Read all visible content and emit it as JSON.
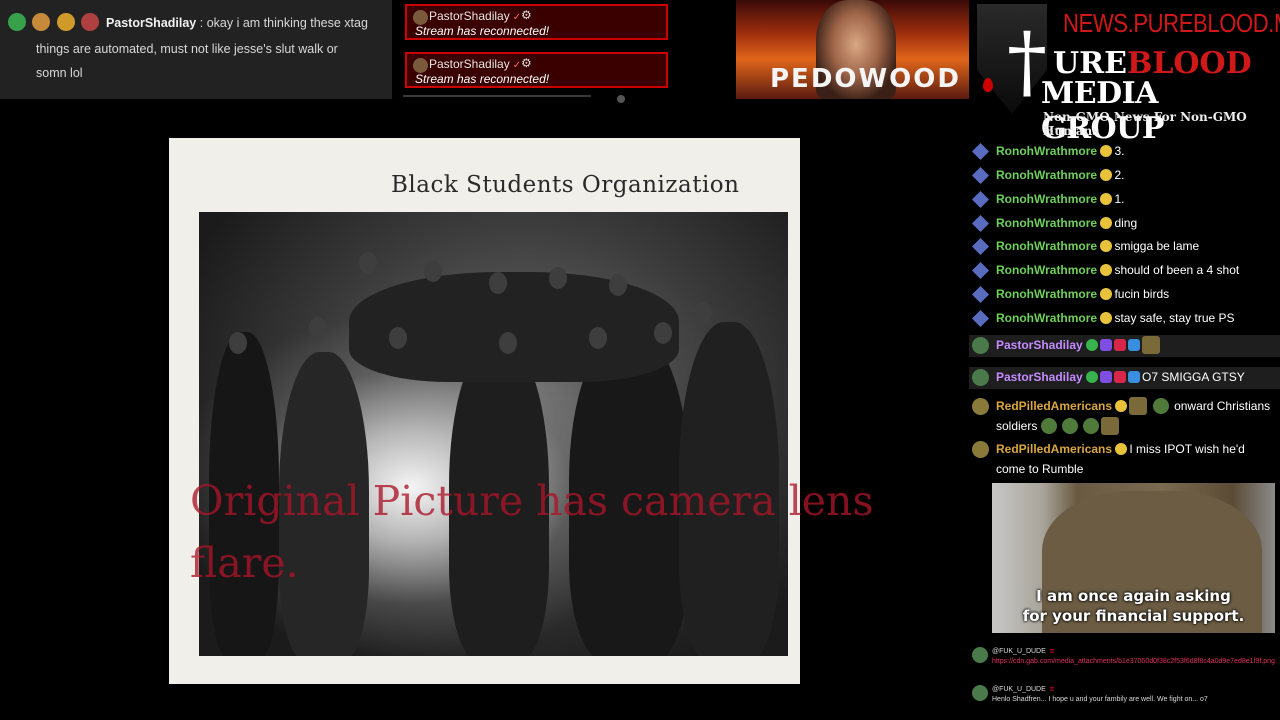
{
  "top_chat": {
    "username": "PastorShadilay",
    "separator": ":",
    "message_line1": "okay i am thinking these xtag",
    "message_line2": "things are automated, must not like jesse's slut walk or",
    "message_line3": "somn lol"
  },
  "notices": [
    {
      "user": "PastorShadilay",
      "check": "✓",
      "gear": "⚙",
      "text": "Stream has reconnected!"
    },
    {
      "user": "PastorShadilay",
      "check": "✓",
      "gear": "⚙",
      "text": "Stream has reconnected!"
    }
  ],
  "banner": {
    "word": "PEDOWOOD"
  },
  "logo": {
    "url": "NEWS.PUREBLOOD.MEDIA",
    "cross": "†",
    "pure_prefix": "URE",
    "pure_red": "BLOOD",
    "media": "MEDIA GROUP",
    "tagline": "Non-GMO News For Non-GMO Humans"
  },
  "photo": {
    "title": "Black Students Organization",
    "caption": "Original Picture has camera lens flare."
  },
  "right_chat": [
    {
      "user": "RonohWrathmore",
      "color": "green",
      "pic": "sat",
      "text": "3."
    },
    {
      "user": "RonohWrathmore",
      "color": "green",
      "pic": "sat",
      "text": "2."
    },
    {
      "user": "RonohWrathmore",
      "color": "green",
      "pic": "sat",
      "text": "1."
    },
    {
      "user": "RonohWrathmore",
      "color": "green",
      "pic": "sat",
      "text": "ding"
    },
    {
      "user": "RonohWrathmore",
      "color": "green",
      "pic": "sat",
      "text": "smigga be lame"
    },
    {
      "user": "RonohWrathmore",
      "color": "green",
      "pic": "sat",
      "text": "should of been a 4 shot"
    },
    {
      "user": "RonohWrathmore",
      "color": "green",
      "pic": "sat",
      "text": "fucin birds"
    },
    {
      "user": "RonohWrathmore",
      "color": "green",
      "pic": "sat",
      "text": "stay safe, stay true PS"
    },
    {
      "user": "PastorShadilay",
      "color": "purple",
      "pic": "round",
      "text": ""
    },
    {
      "user": "PastorShadilay",
      "color": "purple",
      "pic": "round",
      "text": "O7 SMIGGA GTSY"
    },
    {
      "user": "RedPilledAmericans",
      "color": "orange",
      "pic": "round gold",
      "text": "onward Christians",
      "text2": "soldiers"
    },
    {
      "user": "RedPilledAmericans",
      "color": "orange",
      "pic": "round gold",
      "text": "I miss IPOT wish he'd",
      "text2": "come to Rumble"
    }
  ],
  "meme": {
    "line1": "I am once again asking",
    "line2": "for your financial support."
  },
  "mini_chat": [
    {
      "user": "@FUK_U_DUDE",
      "tag": "ㅍ",
      "text": "https://cdn.gab.com/media_attachments/b1e37060d0f38c2f53f6d8f8c4a0d9e7ed8e1f9f.png",
      "kind": "link"
    },
    {
      "user": "@FUK_U_DUDE",
      "tag": "ㅍ",
      "text": "Henlo Shadfren... I hope u and your fambily are well. We fight on... o7",
      "kind": "plain"
    }
  ]
}
